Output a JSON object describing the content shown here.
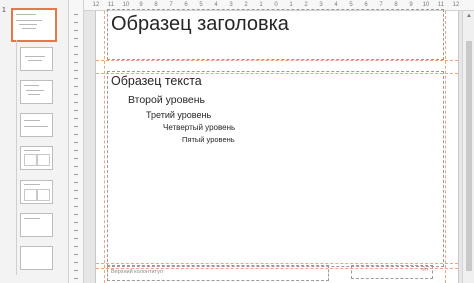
{
  "thumbnails": {
    "master_number": "1",
    "layouts": [
      {
        "label": ""
      },
      {
        "label": ""
      },
      {
        "label": ""
      },
      {
        "label": ""
      },
      {
        "label": ""
      },
      {
        "label": ""
      },
      {
        "label": ""
      },
      {
        "label": ""
      },
      {
        "label": ""
      },
      {
        "label": ""
      }
    ]
  },
  "ruler": {
    "numbers": [
      "12",
      "11",
      "10",
      "9",
      "8",
      "7",
      "6",
      "5",
      "4",
      "3",
      "2",
      "1",
      "0",
      "1",
      "2",
      "3",
      "4",
      "5",
      "6",
      "7",
      "8",
      "9",
      "10",
      "11",
      "12"
    ]
  },
  "slide": {
    "title": "Образец заголовка",
    "levels": [
      "Образец текста",
      "Второй уровень",
      "Третий уровень",
      "Четвертый уровень",
      "Пятый уровень"
    ],
    "footer": "Верхний колонтитул",
    "slide_number_mark": "‹#›"
  },
  "colors": {
    "selection_border": "#e3784b",
    "guide_color": "#f0a283"
  }
}
